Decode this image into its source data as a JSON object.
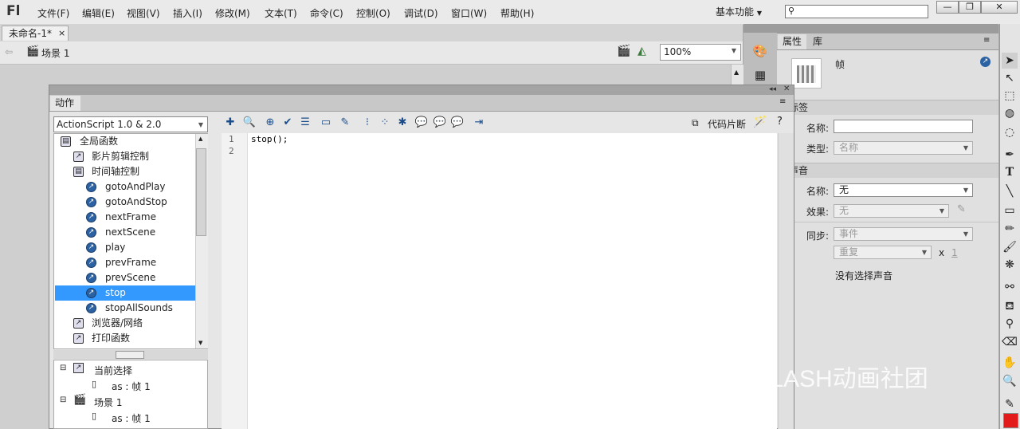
{
  "app": {
    "logo": "Fl"
  },
  "menu": [
    "文件(F)",
    "编辑(E)",
    "视图(V)",
    "插入(I)",
    "修改(M)",
    "文本(T)",
    "命令(C)",
    "控制(O)",
    "调试(D)",
    "窗口(W)",
    "帮助(H)"
  ],
  "workspace": {
    "label": "基本功能"
  },
  "window_buttons": {
    "minimize": "—",
    "restore": "❐",
    "close": "✕"
  },
  "document": {
    "tab_title": "未命名-1*",
    "tab_close": "×",
    "scene": "场景 1",
    "zoom": "100%"
  },
  "properties": {
    "tabs": [
      "属性",
      "库"
    ],
    "frame_title": "帧",
    "section_label": "标签",
    "name_label": "名称:",
    "name_value": "",
    "type_label": "类型:",
    "type_value": "名称",
    "section_sound": "声音",
    "sound_name_label": "名称:",
    "sound_name_value": "无",
    "effect_label": "效果:",
    "effect_value": "无",
    "sync_label": "同步:",
    "sync_value": "事件",
    "repeat_value": "重复",
    "repeat_x": "x",
    "repeat_count": "1",
    "no_sound": "没有选择声音"
  },
  "actions": {
    "tab_label": "动作",
    "version": "ActionScript 1.0 & 2.0",
    "tree": [
      {
        "label": "全局函数",
        "indent": 0,
        "icon": "book"
      },
      {
        "label": "影片剪辑控制",
        "indent": 1,
        "icon": "book"
      },
      {
        "label": "时间轴控制",
        "indent": 1,
        "icon": "book"
      },
      {
        "label": "gotoAndPlay",
        "indent": 2,
        "icon": "fn"
      },
      {
        "label": "gotoAndStop",
        "indent": 2,
        "icon": "fn"
      },
      {
        "label": "nextFrame",
        "indent": 2,
        "icon": "fn"
      },
      {
        "label": "nextScene",
        "indent": 2,
        "icon": "fn"
      },
      {
        "label": "play",
        "indent": 2,
        "icon": "fn"
      },
      {
        "label": "prevFrame",
        "indent": 2,
        "icon": "fn"
      },
      {
        "label": "prevScene",
        "indent": 2,
        "icon": "fn"
      },
      {
        "label": "stop",
        "indent": 2,
        "icon": "fn",
        "selected": true
      },
      {
        "label": "stopAllSounds",
        "indent": 2,
        "icon": "fn"
      },
      {
        "label": "浏览器/网络",
        "indent": 1,
        "icon": "book"
      },
      {
        "label": "打印函数",
        "indent": 1,
        "icon": "book"
      }
    ],
    "current_selection": "当前选择",
    "as_frame": "as : 帧 1",
    "scene": "场景 1",
    "scene_frame": "as : 帧 1",
    "code_snippets": "代码片断",
    "line_numbers": [
      "1",
      "2"
    ],
    "code": "stop();"
  },
  "watermark": "FLASH动画社团"
}
